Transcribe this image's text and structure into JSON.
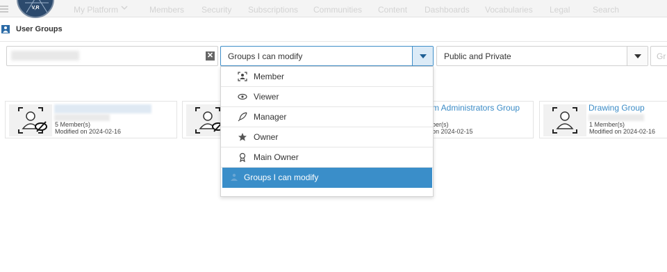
{
  "nav": {
    "logo_text": "V,R",
    "platform": "My Platform",
    "items": [
      "Members",
      "Security",
      "Subscriptions",
      "Communities",
      "Content",
      "Dashboards",
      "Vocabularies",
      "Legal",
      "Search"
    ]
  },
  "page": {
    "title": "User Groups"
  },
  "filters": {
    "group_filter": "Groups I can modify",
    "visibility_filter": "Public and Private",
    "third_filter_placeholder": "Gr"
  },
  "dropdown": {
    "options": [
      {
        "label": "Member",
        "icon": "member-icon"
      },
      {
        "label": "Viewer",
        "icon": "eye-icon"
      },
      {
        "label": "Manager",
        "icon": "feather-icon"
      },
      {
        "label": "Owner",
        "icon": "star-icon"
      },
      {
        "label": "Main Owner",
        "icon": "award-icon"
      },
      {
        "label": "Groups I can modify",
        "icon": "group-icon",
        "selected": true
      }
    ]
  },
  "cards": [
    {
      "name": "",
      "members": "5 Member(s)",
      "modified": "Modified on 2024-02-16"
    },
    {
      "name": "",
      "members": "",
      "modified": ""
    },
    {
      "name": "m Administrators Group",
      "members": "ber(s)",
      "modified": "on 2024-02-15"
    },
    {
      "name": "Drawing Group",
      "members": "1 Member(s)",
      "modified": "Modified on 2024-02-16"
    }
  ],
  "colors": {
    "accent": "#3a8ec9",
    "link": "#3b8bc6",
    "logo_bg": "#2c4a6d"
  }
}
